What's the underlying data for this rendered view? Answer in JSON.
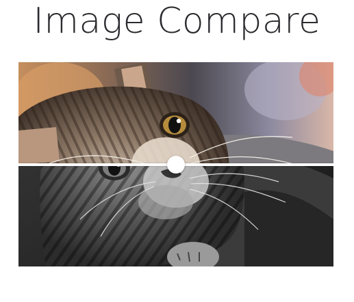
{
  "page": {
    "title": "Image Compare"
  },
  "compare": {
    "position_percent": 50,
    "before_image": "cat-photo-color",
    "after_image": "cat-photo-grayscale",
    "handle_icon": "circle-handle-icon"
  },
  "colors": {
    "title": "#2a2a2e",
    "divider": "#ffffff",
    "handle": "#ffffff"
  }
}
